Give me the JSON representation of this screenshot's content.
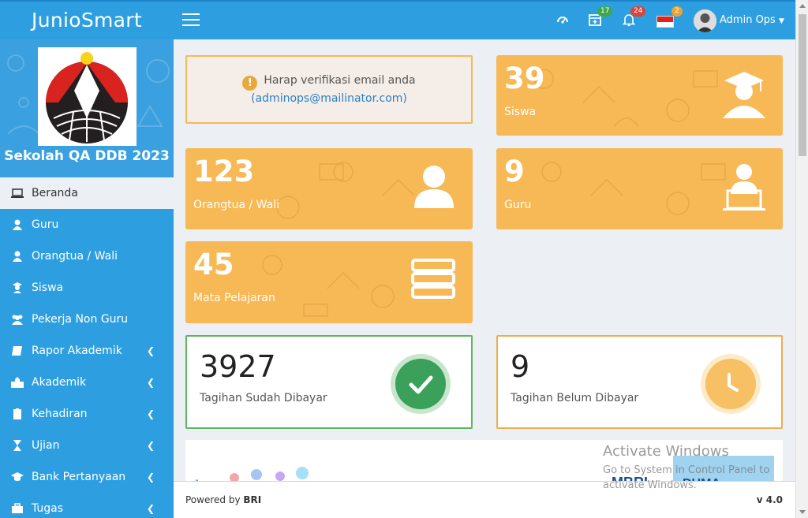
{
  "app": {
    "brand": "JunioSmart"
  },
  "header": {
    "badges": {
      "calendar": "17",
      "bell": "24",
      "flag": "2"
    },
    "user_name": "Admin Ops"
  },
  "sidebar": {
    "school_name": "Sekolah QA DDB 2023",
    "items": [
      {
        "label": "Beranda",
        "icon": "laptop-icon"
      },
      {
        "label": "Guru",
        "icon": "user-icon"
      },
      {
        "label": "Orangtua / Wali",
        "icon": "user-icon"
      },
      {
        "label": "Siswa",
        "icon": "student-icon"
      },
      {
        "label": "Pekerja Non Guru",
        "icon": "users-icon"
      },
      {
        "label": "Rapor Akademik",
        "icon": "book-icon"
      },
      {
        "label": "Akademik",
        "icon": "school-icon"
      },
      {
        "label": "Kehadiran",
        "icon": "clipboard-icon"
      },
      {
        "label": "Ujian",
        "icon": "hourglass-icon"
      },
      {
        "label": "Bank Pertanyaan",
        "icon": "graduation-cap-icon"
      },
      {
        "label": "Tugas",
        "icon": "briefcase-icon"
      }
    ]
  },
  "notice": {
    "text": "Harap verifikasi email anda",
    "email": "(adminops@mailinator.com)"
  },
  "stats": {
    "siswa": {
      "value": "39",
      "label": "Siswa"
    },
    "orangtua": {
      "value": "123",
      "label": "Orangtua / Wali"
    },
    "guru": {
      "value": "9",
      "label": "Guru"
    },
    "mapel": {
      "value": "45",
      "label": "Mata Pelajaran"
    }
  },
  "bills": {
    "paid": {
      "value": "3927",
      "label": "Tagihan Sudah Dibayar"
    },
    "unpaid": {
      "value": "9",
      "label": "Tagihan Belum Dibayar"
    }
  },
  "footer": {
    "powered": "Powered by BRI",
    "version": "v 4.0"
  },
  "watermark": {
    "line1": "Activate Windows",
    "line2": "Go to System in Control Panel to activate Windows."
  },
  "colors": {
    "primary": "#2d9fe0",
    "stat": "#f7b955",
    "success": "#3aa05a",
    "warning": "#f7b955"
  }
}
